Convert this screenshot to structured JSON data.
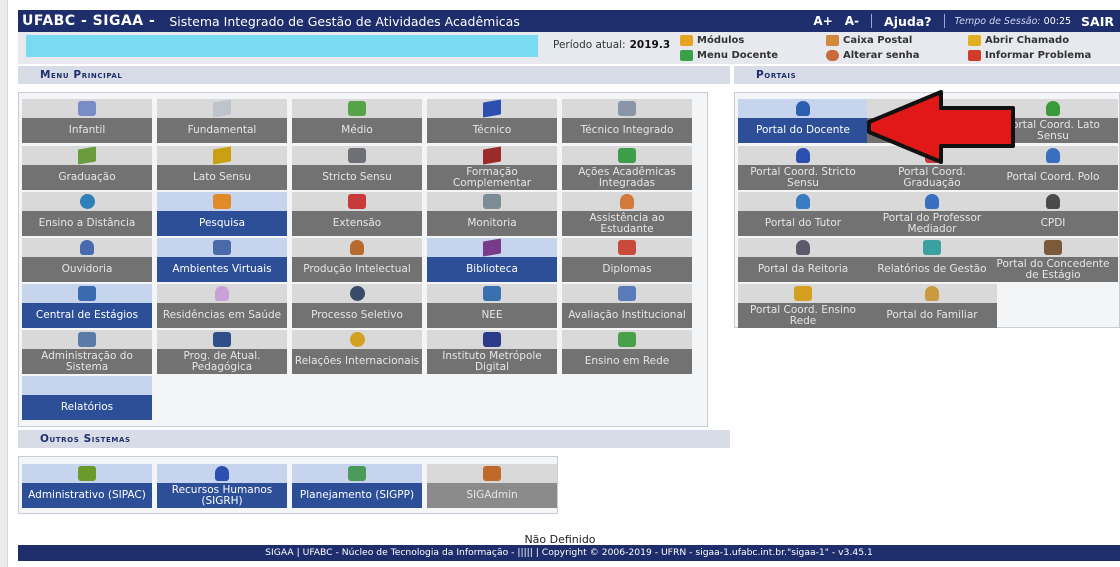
{
  "header": {
    "brand": "UFABC - SIGAA -",
    "system_name": "Sistema Integrado de Gestão de Atividades Acadêmicas",
    "font_increase": "A+",
    "font_decrease": "A-",
    "help": "Ajuda?",
    "session_label": "Tempo de Sessão:",
    "session_time": "00:25",
    "logout": "SAIR"
  },
  "info": {
    "period_label": "Período atual:",
    "period_value": "2019.3",
    "links": {
      "modules": "Módulos",
      "inbox": "Caixa Postal",
      "open_ticket": "Abrir Chamado",
      "teacher_menu": "Menu Docente",
      "change_password": "Alterar senha",
      "report_problem": "Informar Problema"
    }
  },
  "sections": {
    "main_menu": "Menu Principal",
    "portals": "Portais",
    "other_systems": "Outros Sistemas"
  },
  "main_menu": [
    {
      "label": "Infantil",
      "icon": "crayons-icon",
      "color": "#7a8cc8"
    },
    {
      "label": "Fundamental",
      "icon": "notebook-icon",
      "color": "#bfc3cc"
    },
    {
      "label": "Médio",
      "icon": "pencil-icon",
      "color": "#55a447"
    },
    {
      "label": "Técnico",
      "icon": "book-icon",
      "color": "#2c4fb0"
    },
    {
      "label": "Técnico Integrado",
      "icon": "drawing-icon",
      "color": "#8a96a8"
    },
    {
      "label": "Graduação",
      "icon": "books-icon",
      "color": "#6a9b3c"
    },
    {
      "label": "Lato Sensu",
      "icon": "book-icon",
      "color": "#c9a012"
    },
    {
      "label": "Stricto Sensu",
      "icon": "case-icon",
      "color": "#6f7075"
    },
    {
      "label": "Formação Complementar",
      "icon": "book-icon",
      "color": "#9b2a2a"
    },
    {
      "label": "Ações Acadêmicas Integradas",
      "icon": "puzzle-icon",
      "color": "#3e9d4a"
    },
    {
      "label": "Ensino a Distância",
      "icon": "globe-icon",
      "color": "#2f7fb8"
    },
    {
      "label": "Pesquisa",
      "icon": "flask-icon",
      "color": "#e08a2a"
    },
    {
      "label": "Extensão",
      "icon": "megaphone-icon",
      "color": "#c83a3a"
    },
    {
      "label": "Monitoria",
      "icon": "board-icon",
      "color": "#7e8c96"
    },
    {
      "label": "Assistência ao Estudante",
      "icon": "student-icon",
      "color": "#d17a3a"
    },
    {
      "label": "Ouvidoria",
      "icon": "headset-icon",
      "color": "#4a6ab0"
    },
    {
      "label": "Ambientes Virtuais",
      "icon": "group-icon",
      "color": "#4b6aa8"
    },
    {
      "label": "Produção Intelectual",
      "icon": "person-check-icon",
      "color": "#b76a2c"
    },
    {
      "label": "Biblioteca",
      "icon": "books-icon",
      "color": "#7a3a8a"
    },
    {
      "label": "Diplomas",
      "icon": "certificate-icon",
      "color": "#c94a3a"
    },
    {
      "label": "Central de Estágios",
      "icon": "id-card-icon",
      "color": "#3a6ab0"
    },
    {
      "label": "Residências em Saúde",
      "icon": "doctor-icon",
      "color": "#c9a0d8"
    },
    {
      "label": "Processo Seletivo",
      "icon": "copyright-icon",
      "color": "#3a4a6a"
    },
    {
      "label": "NEE",
      "icon": "accessibility-icon",
      "color": "#3a6fb0"
    },
    {
      "label": "Avaliação Institucional",
      "icon": "evaluation-icon",
      "color": "#5a7ab8"
    },
    {
      "label": "Administração do Sistema",
      "icon": "gears-icon",
      "color": "#5a7aa8"
    },
    {
      "label": "Prog. de Atual. Pedagógica",
      "icon": "presentation-icon",
      "color": "#2f4f8a"
    },
    {
      "label": "Relações Internacionais",
      "icon": "world-icon",
      "color": "#d4a020"
    },
    {
      "label": "Instituto Metrópole Digital",
      "icon": "imd-logo",
      "color": "#2c3a8a"
    },
    {
      "label": "Ensino em Rede",
      "icon": "network-icon",
      "color": "#4aa04a"
    },
    {
      "label": "Relatórios",
      "icon": "",
      "color": ""
    }
  ],
  "portals": [
    {
      "label": "Portal do Docente",
      "icon": "teacher-icon",
      "color": "#2c5fb0"
    },
    {
      "label": "Portal ...",
      "icon": "person-icon",
      "color": "#c99a40"
    },
    {
      "label": "Portal Coord. Lato Sensu",
      "icon": "person-icon",
      "color": "#3a9a3a"
    },
    {
      "label": "Portal Coord. Stricto Sensu",
      "icon": "person-icon",
      "color": "#2c4fb0"
    },
    {
      "label": "Portal Coord. Graduação",
      "icon": "person-icon",
      "color": "#c83a3a"
    },
    {
      "label": "Portal Coord. Polo",
      "icon": "person-icon",
      "color": "#3a6fc0"
    },
    {
      "label": "Portal do Tutor",
      "icon": "person-icon",
      "color": "#3a7ac0"
    },
    {
      "label": "Portal do Professor Mediador",
      "icon": "person-icon",
      "color": "#3a6fc0"
    },
    {
      "label": "CPDI",
      "icon": "person-icon",
      "color": "#4a4a4a"
    },
    {
      "label": "Portal da Reitoria",
      "icon": "person-icon",
      "color": "#5a5a6a"
    },
    {
      "label": "Relatórios de Gestão",
      "icon": "chart-icon",
      "color": "#3aa0a0"
    },
    {
      "label": "Portal do Concedente de Estágio",
      "icon": "handshake-icon",
      "color": "#7a5a3a"
    },
    {
      "label": "Portal Coord. Ensino Rede",
      "icon": "network-icon",
      "color": "#d4a020"
    },
    {
      "label": "Portal do Familiar",
      "icon": "family-icon",
      "color": "#c99a40"
    }
  ],
  "other_systems": [
    {
      "label": "Administrativo (SIPAC)",
      "icon": "admin-icon",
      "color": "#6a9a2a"
    },
    {
      "label": "Recursos Humanos (SIGRH)",
      "icon": "person-icon",
      "color": "#2c4fb0"
    },
    {
      "label": "Planejamento (SIGPP)",
      "icon": "planning-icon",
      "color": "#4a9a5a"
    },
    {
      "label": "SIGAdmin",
      "icon": "admin-users-icon",
      "color": "#c06a2a"
    }
  ],
  "footer": {
    "undefined_text": "Não Definido",
    "text": "SIGAA | UFABC - Núcleo de Tecnologia da Informação - ||||| | Copyright © 2006-2019 - UFRN - sigaa-1.ufabc.int.br.\"sigaa-1\" - v3.45.1"
  },
  "annotation": {
    "arrow_color": "#e11818"
  }
}
